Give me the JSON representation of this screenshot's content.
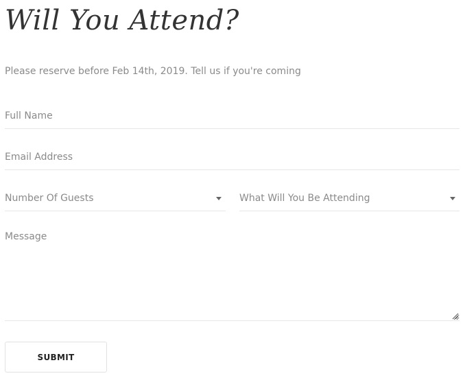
{
  "header": {
    "title": "Will You Attend?",
    "subtitle": "Please reserve before Feb 14th, 2019. Tell us if you're coming"
  },
  "form": {
    "full_name": {
      "placeholder": "Full Name",
      "value": ""
    },
    "email": {
      "placeholder": "Email Address",
      "value": ""
    },
    "guests": {
      "selected": "Number Of Guests"
    },
    "attending": {
      "selected": "What Will You Be Attending"
    },
    "message": {
      "placeholder": "Message",
      "value": ""
    },
    "submit_label": "SUBMIT"
  },
  "icons": {
    "guests_caret": "chevron-down-icon",
    "attending_caret": "chevron-down-icon",
    "textarea_grip": "resize-grip-icon"
  },
  "colors": {
    "title": "#333333",
    "text": "#8a8a8a",
    "border": "#e6e6e6"
  }
}
